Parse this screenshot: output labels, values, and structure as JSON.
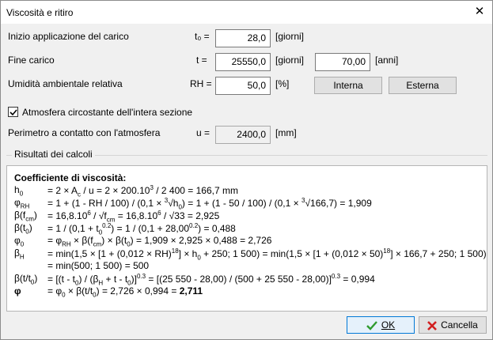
{
  "window": {
    "title": "Viscosità e ritiro",
    "close": "✕"
  },
  "form": {
    "load_start": {
      "label": "Inizio applicazione del carico",
      "sym": "t₀ =",
      "value": "28,0",
      "unit": "[giorni]"
    },
    "load_end": {
      "label": "Fine carico",
      "sym": "t =",
      "value": "25550,0",
      "unit": "[giorni]",
      "value2": "70,00",
      "unit2": "[anni]"
    },
    "humidity": {
      "label": "Umidità ambientale relativa",
      "sym": "RH =",
      "value": "50,0",
      "unit": "[%]"
    },
    "btn_internal": "Interna",
    "btn_external": "Esterna",
    "atmosphere_check": {
      "label": "Atmosfera circostante dell'intera sezione",
      "checked": true
    },
    "perimeter": {
      "label": "Perimetro a contatto con l'atmosfera",
      "sym": "u =",
      "value": "2400,0",
      "unit": "[mm]"
    }
  },
  "results": {
    "group_title": "Risultati dei calcoli",
    "heading": "Coefficiente di viscosità:",
    "h0": {
      "expr": "=  2 × A",
      "expr2": " / u = 2 × 200.10",
      "expr3": " / 2 400 = 166,7 mm"
    },
    "phiRH": {
      "expr": "=  1 + (1 - RH / 100) / (0,1 × ",
      "expr2": "√h",
      "expr3": ") = 1 + (1 - 50 / 100) / (0,1 × ",
      "expr4": "√166,7) = 1,909"
    },
    "beta_fcm": {
      "expr": "=  16,8.10",
      "expr2": " / √f",
      "expr3": " = 16,8.10",
      "expr4": " / √33 = 2,925"
    },
    "beta_t0": {
      "expr": "=  1 / (0,1 + t",
      "expr2": ") = 1 / (0,1 + 28,00",
      "expr3": ") = 0,488"
    },
    "phi0": {
      "expr": "=  φ",
      "expr2": " × β(f",
      "expr3": ") × β(t",
      "expr4": ") = 1,909 × 2,925 × 0,488 = 2,726"
    },
    "betaH": {
      "line1a": "=  min(1,5 × [1 + (0,012 × RH)",
      "line1b": "] × h",
      "line1c": " + 250; 1 500) = min(1,5 × [1 + (0,012 × 50)",
      "line1d": "] × 166,7 + 250; 1 500)",
      "line2": "= min(500; 1 500) = 500"
    },
    "beta_tt0": {
      "expr": "=  [(t - t",
      "expr2": ") / (β",
      "expr3": " + t - t",
      "expr4": ")]",
      "expr5": " = [(25 550 - 28,00) / (500 + 25 550 - 28,00)]",
      "expr6": " = 0,994"
    },
    "phi": {
      "expr": "=  φ",
      "expr2": " × β(t/t",
      "expr3": ") = 2,726 × 0,994 = ",
      "result": "2,711"
    }
  },
  "buttons": {
    "ok": "OK",
    "cancel": "Cancella"
  },
  "colors": {
    "ok_icon": "#2e9b2e",
    "cancel_icon": "#d21f1f",
    "accent": "#0078d7"
  }
}
